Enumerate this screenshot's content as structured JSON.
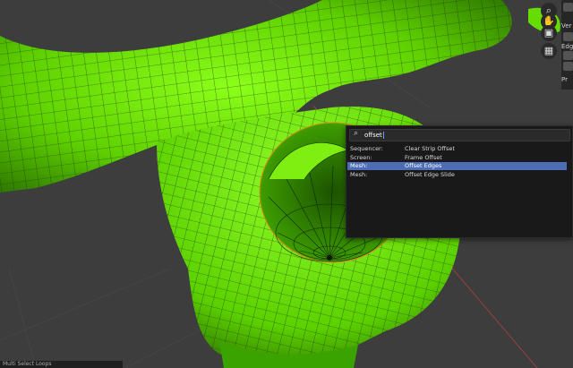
{
  "search": {
    "query": "offset",
    "results": [
      {
        "category": "Sequencer:",
        "item": "Clear Strip Offset"
      },
      {
        "category": "Screen:",
        "item": "Frame Offset"
      },
      {
        "category": "Mesh:",
        "item": "Offset Edges"
      },
      {
        "category": "Mesh:",
        "item": "Offset Edge Slide"
      }
    ],
    "active_index": 2
  },
  "status": {
    "text": "Multi Select Loops"
  },
  "npanel": {
    "labels": [
      "Ver",
      "Edg",
      "Pr"
    ]
  },
  "icons": [
    "search-icon",
    "hand-icon",
    "camera-icon",
    "grid-icon"
  ],
  "colors": {
    "mesh": "#63e100",
    "wire": "#1f3a05",
    "highlight": "#4d6eb4",
    "popup": "#191919"
  }
}
